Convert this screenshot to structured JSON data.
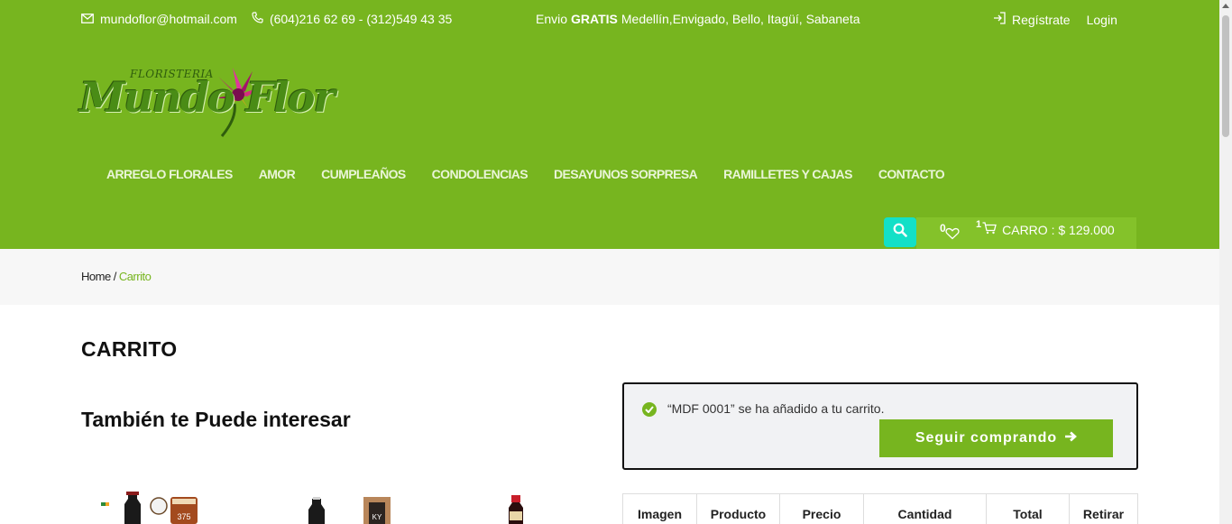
{
  "topbar": {
    "email": "mundoflor@hotmail.com",
    "phones": "(604)216 62 69 - (312)549 43 35",
    "shipping_prefix": "Envio",
    "shipping_bold": "GRATIS",
    "shipping_cities": "Medellín,Envigado, Bello, Itagüí, Sabaneta",
    "register_label": "Regístrate",
    "login_label": "Login"
  },
  "logo": {
    "small": "FLORISTERIA",
    "big": "Mundo Flor"
  },
  "nav": {
    "items": [
      "ARREGLO FLORALES",
      "AMOR",
      "CUMPLEAÑOS",
      "CONDOLENCIAS",
      "DESAYUNOS SORPRESA",
      "RAMILLETES Y CAJAS",
      "CONTACTO"
    ]
  },
  "header_tools": {
    "wishlist_count": "0",
    "cart_count": "1",
    "cart_label": "CARRO : $ 129.000"
  },
  "breadcrumb": {
    "home": "Home",
    "sep": "/",
    "current": "Carrito"
  },
  "page": {
    "title": "CARRITO",
    "related_title": "También te Puede interesar"
  },
  "notice": {
    "message": "“MDF 0001” se ha añadido a tu carrito.",
    "button_label": "Seguir comprando"
  },
  "table": {
    "headers": [
      "Imagen",
      "Producto",
      "Precio",
      "Cantidad",
      "Total",
      "Retirar"
    ]
  },
  "colors": {
    "brand_green": "#77b51f",
    "search_teal": "#13e0c7"
  }
}
